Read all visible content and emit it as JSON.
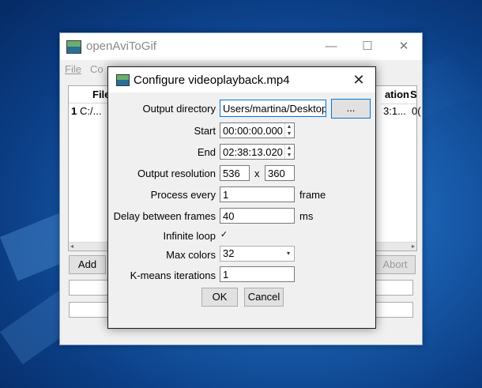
{
  "colors": {
    "desktop": "#1a5fb0",
    "accent": "#0078d7",
    "window_bg": "#f0f0f0"
  },
  "main_window": {
    "title": "openAviToGif",
    "controls": {
      "minimize": "—",
      "maximize": "☐",
      "close": "✕"
    },
    "menu": [
      "File",
      "Co"
    ],
    "table": {
      "columns": [
        "File",
        "ation",
        "S"
      ],
      "rows": [
        {
          "row_number": "1",
          "file": "C:/...",
          "duration": "3:1...",
          "start": "0("
        }
      ]
    },
    "buttons": {
      "add": "Add",
      "abort": "Abort"
    }
  },
  "dialog": {
    "title": "Configure videoplayback.mp4",
    "close_icon": "close-icon",
    "fields": {
      "output_directory": {
        "label": "Output directory",
        "value": "Users/martina/Desktop",
        "browse": "..."
      },
      "start": {
        "label": "Start",
        "value": "00:00:00.000"
      },
      "end": {
        "label": "End",
        "value": "02:38:13.020"
      },
      "resolution": {
        "label": "Output resolution",
        "width": "536",
        "separator": "x",
        "height": "360"
      },
      "process_every": {
        "label": "Process every",
        "value": "1",
        "unit": "frame"
      },
      "delay": {
        "label": "Delay between frames",
        "value": "40",
        "unit": "ms"
      },
      "infinite_loop": {
        "label": "Infinite loop",
        "checked": true,
        "mark": "✓"
      },
      "max_colors": {
        "label": "Max colors",
        "value": "32"
      },
      "kmeans": {
        "label": "K-means iterations",
        "value": "1"
      }
    },
    "buttons": {
      "ok": "OK",
      "cancel": "Cancel"
    }
  }
}
